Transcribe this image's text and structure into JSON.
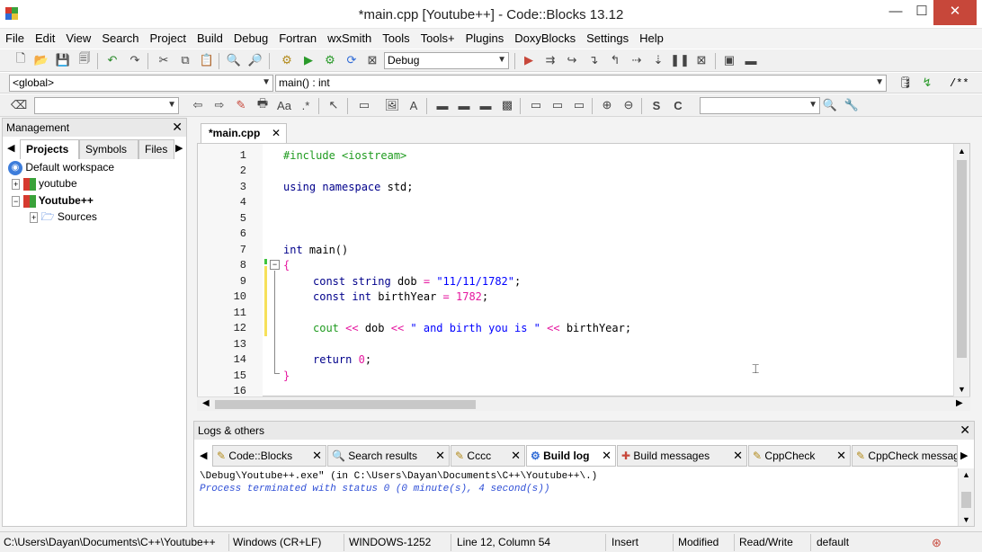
{
  "window": {
    "title": "*main.cpp [Youtube++] - Code::Blocks 13.12",
    "min": "—",
    "max": "☐",
    "close": "✕"
  },
  "menu": [
    "File",
    "Edit",
    "View",
    "Search",
    "Project",
    "Build",
    "Debug",
    "Fortran",
    "wxSmith",
    "Tools",
    "Tools+",
    "Plugins",
    "DoxyBlocks",
    "Settings",
    "Help"
  ],
  "toolbar": {
    "build_target": "Debug",
    "scope": "<global>",
    "symbol": "main() : int",
    "search_value": "",
    "doxy_comment": "/**"
  },
  "management": {
    "title": "Management",
    "tabs": [
      "Projects",
      "Symbols",
      "Files"
    ],
    "tree": [
      {
        "label": "Default workspace",
        "bold": false
      },
      {
        "label": "youtube",
        "bold": false
      },
      {
        "label": "Youtube++",
        "bold": true
      },
      {
        "label": "Sources",
        "bold": false
      }
    ]
  },
  "editor": {
    "tab": "*main.cpp",
    "line_numbers": [
      "1",
      "2",
      "3",
      "4",
      "5",
      "6",
      "7",
      "8",
      "9",
      "10",
      "11",
      "12",
      "13",
      "14",
      "15",
      "16"
    ],
    "lines": {
      "l1": "#include <iostream>",
      "l3_kw": "using namespace",
      "l3_rest": " std;",
      "l7_kw": "int",
      "l7_rest": " main()",
      "l8": "{",
      "l9_kw": "const",
      "l9_t": "string",
      "l9_v": " dob ",
      "l9_op": "=",
      "l9_s": "\"11/11/1782\"",
      "l9_e": ";",
      "l10_kw": "const",
      "l10_t": "int",
      "l10_v": " birthYear ",
      "l10_op": "=",
      "l10_n": "1782",
      "l10_e": ";",
      "l12_a": "cout",
      "l12_op1": "<<",
      "l12_v": " dob ",
      "l12_op2": "<<",
      "l12_s": "\" and birth you is \"",
      "l12_op3": "<<",
      "l12_e": " birthYear;",
      "l14_kw": "return",
      "l14_n": "0",
      "l14_e": ";",
      "l15": "}"
    }
  },
  "logs": {
    "title": "Logs & others",
    "tabs": [
      "Code::Blocks",
      "Search results",
      "Cccc",
      "Build log",
      "Build messages",
      "CppCheck",
      "CppCheck messag"
    ],
    "active_tab": "Build log",
    "lines": [
      "\\Debug\\Youtube++.exe\"  (in C:\\Users\\Dayan\\Documents\\C++\\Youtube++\\.)",
      "Process terminated with status 0 (0 minute(s), 4 second(s))"
    ]
  },
  "status": {
    "path": "C:\\Users\\Dayan\\Documents\\C++\\Youtube++",
    "eol": "Windows (CR+LF)",
    "encoding": "WINDOWS-1252",
    "position": "Line 12, Column 54",
    "mode": "Insert",
    "modified": "Modified",
    "access": "Read/Write",
    "profile": "default"
  },
  "colors": {
    "keyword": "#00008b",
    "string": "#0000ff",
    "number": "#e5179f",
    "preprocessor": "#1f9b1f",
    "close_button": "#c7473a"
  }
}
